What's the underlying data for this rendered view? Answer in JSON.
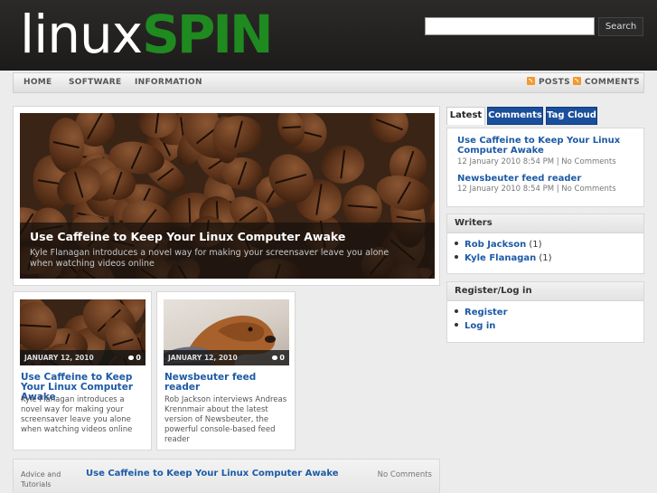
{
  "header": {
    "logo_part1": "linux",
    "logo_part2": "SPIN",
    "search_placeholder": "",
    "search_button": "Search"
  },
  "nav": {
    "items": [
      "HOME",
      "SOFTWARE",
      "INFORMATION"
    ],
    "feeds": [
      "POSTS",
      "COMMENTS"
    ]
  },
  "featured": {
    "title": "Use Caffeine to Keep Your Linux Computer Awake",
    "description": "Kyle Flanagan introduces a novel way for making your screensaver leave you alone when watching videos online"
  },
  "cards": [
    {
      "date": "JANUARY 12, 2010",
      "comments": "0",
      "title": "Use Caffeine to Keep Your Linux Computer Awake",
      "description": "Kyle Flanagan introduces a novel way for making your screensaver leave you alone when watching videos online"
    },
    {
      "date": "JANUARY 12, 2010",
      "comments": "0",
      "title": "Newsbeuter feed reader",
      "description": "Rob Jackson interviews Andreas Krennmair about the latest version of Newsbeuter, the powerful console-based feed reader"
    }
  ],
  "bottom_post": {
    "category": "Advice and Tutorials",
    "title": "Use Caffeine to Keep Your Linux Computer Awake",
    "comments": "No Comments"
  },
  "sidebar": {
    "tabs": [
      "Latest",
      "Comments",
      "Tag Cloud"
    ],
    "latest": [
      {
        "title": "Use Caffeine to Keep Your Linux Computer Awake",
        "meta": "12 January 2010 8:54 PM | No Comments"
      },
      {
        "title": "Newsbeuter feed reader",
        "meta": "12 January 2010 8:54 PM | No Comments"
      }
    ],
    "writers": {
      "heading": "Writers",
      "items": [
        {
          "name": "Rob Jackson",
          "count": "(1)"
        },
        {
          "name": "Kyle Flanagan",
          "count": "(1)"
        }
      ]
    },
    "register": {
      "heading": "Register/Log in",
      "items": [
        "Register",
        "Log in"
      ]
    }
  },
  "colors": {
    "header_bg": "#1d1b1a",
    "logo_green": "#1f8a1f",
    "link_blue": "#1c5aa6",
    "tab_blue": "#1a4f9c"
  }
}
